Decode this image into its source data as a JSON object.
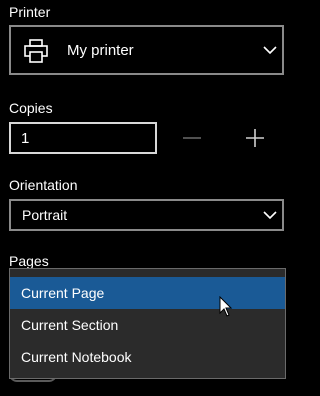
{
  "printer": {
    "label": "Printer",
    "selected": "My printer",
    "icon": "printer-icon"
  },
  "copies": {
    "label": "Copies",
    "value": "1",
    "decrement_icon": "minus-icon",
    "increment_icon": "plus-icon"
  },
  "orientation": {
    "label": "Orientation",
    "selected": "Portrait"
  },
  "pages": {
    "label": "Pages",
    "options": [
      {
        "label": "Current Page",
        "selected": true
      },
      {
        "label": "Current Section",
        "selected": false
      },
      {
        "label": "Current Notebook",
        "selected": false
      }
    ]
  },
  "colors": {
    "background": "#000000",
    "popup_background": "#2b2b2b",
    "selected_item": "#1a5a96",
    "border": "#8a8a8a"
  }
}
